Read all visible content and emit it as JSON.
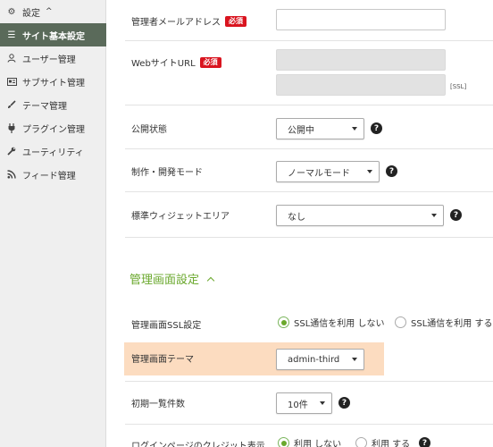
{
  "sidebar": {
    "header": "設定",
    "items": [
      {
        "label": "サイト基本設定",
        "icon": "list-icon"
      },
      {
        "label": "ユーザー管理",
        "icon": "user-icon"
      },
      {
        "label": "サブサイト管理",
        "icon": "id-card-icon"
      },
      {
        "label": "テーマ管理",
        "icon": "brush-icon"
      },
      {
        "label": "プラグイン管理",
        "icon": "plug-icon"
      },
      {
        "label": "ユーティリティ",
        "icon": "wrench-icon"
      },
      {
        "label": "フィード管理",
        "icon": "rss-icon"
      }
    ]
  },
  "form": {
    "required_badge": "必須",
    "admin_email": {
      "label": "管理者メールアドレス",
      "value": ""
    },
    "site_url": {
      "label": "WebサイトURL",
      "ssl_tag": "[SSL]"
    },
    "status": {
      "label": "公開状態",
      "value": "公開中"
    },
    "mode": {
      "label": "制作・開発モード",
      "value": "ノーマルモード"
    },
    "widget_area": {
      "label": "標準ウィジェットエリア",
      "value": "なし"
    }
  },
  "admin_section": {
    "title": "管理画面設定",
    "ssl": {
      "label": "管理画面SSL設定",
      "options": [
        "SSL通信を利用 しない",
        "SSL通信を利用 する"
      ],
      "selected": 0
    },
    "theme": {
      "label": "管理画面テーマ",
      "value": "admin-third"
    },
    "list_count": {
      "label": "初期一覧件数",
      "value": "10件"
    },
    "credit": {
      "label": "ログインページのクレジット表示",
      "options": [
        "利用 しない",
        "利用 する"
      ],
      "selected": 0
    }
  },
  "help_glyph": "?",
  "colors": {
    "accent": "#6aa82c",
    "required": "#d9141f",
    "highlight": "#fcdcc0",
    "sidebar_active": "#5a6a5a"
  }
}
